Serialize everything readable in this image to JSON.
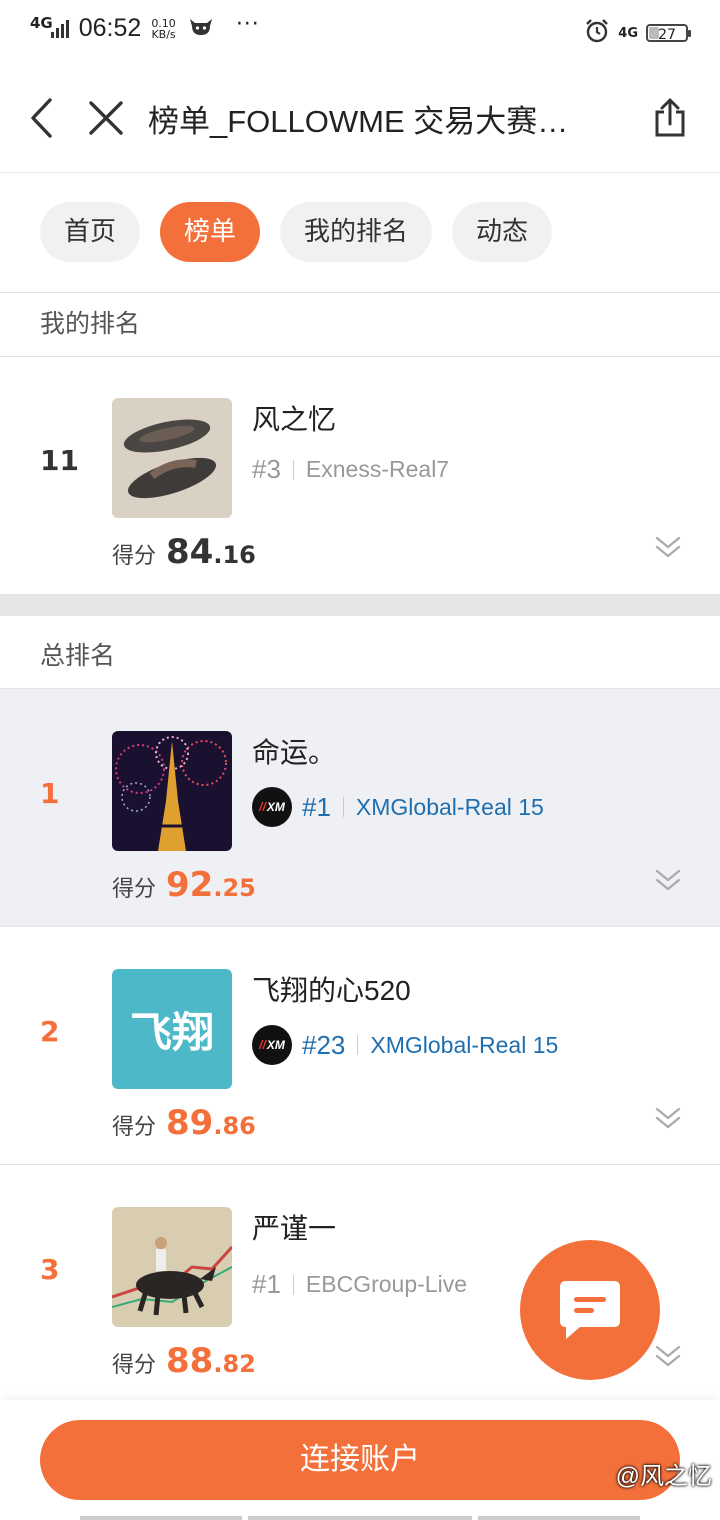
{
  "status_bar": {
    "network": "4G",
    "time": "06:52",
    "speed_value": "0.10",
    "speed_unit": "KB/s",
    "dots": "···",
    "right_network": "4G",
    "battery": "27"
  },
  "nav": {
    "title": "榜单_FOLLOWME 交易大赛…"
  },
  "tabs": [
    {
      "label": "首页"
    },
    {
      "label": "榜单"
    },
    {
      "label": "我的排名"
    },
    {
      "label": "动态"
    }
  ],
  "my_rank_section": {
    "title": "我的排名",
    "entry": {
      "rank": "11",
      "name": "风之忆",
      "server_no": "#3",
      "server": "Exness-Real7",
      "score_label": "得分",
      "score_int": "84",
      "score_dec": ".16"
    }
  },
  "overall_section": {
    "title": "总排名",
    "entries": [
      {
        "rank": "1",
        "name": "命运。",
        "broker_logo": "XM",
        "server_no": "#1",
        "server": "XMGlobal-Real 15",
        "score_label": "得分",
        "score_int": "92",
        "score_dec": ".25"
      },
      {
        "rank": "2",
        "name": "飞翔的心520",
        "avatar_text": "飞翔",
        "broker_logo": "XM",
        "server_no": "#23",
        "server": "XMGlobal-Real 15",
        "score_label": "得分",
        "score_int": "89",
        "score_dec": ".86"
      },
      {
        "rank": "3",
        "name": "严谨一",
        "server_no": "#1",
        "server": "EBCGroup-Live",
        "score_label": "得分",
        "score_int": "88",
        "score_dec": ".82"
      }
    ]
  },
  "bottom": {
    "connect_label": "连接账户",
    "watermark": "@风之忆"
  },
  "colors": {
    "accent": "#f4703a",
    "link_blue": "#1f6fb0",
    "gray_text": "#999999"
  },
  "icons": [
    "back-icon",
    "close-icon",
    "share-icon",
    "chevron-down-icon",
    "chat-icon",
    "alarm-icon"
  ]
}
